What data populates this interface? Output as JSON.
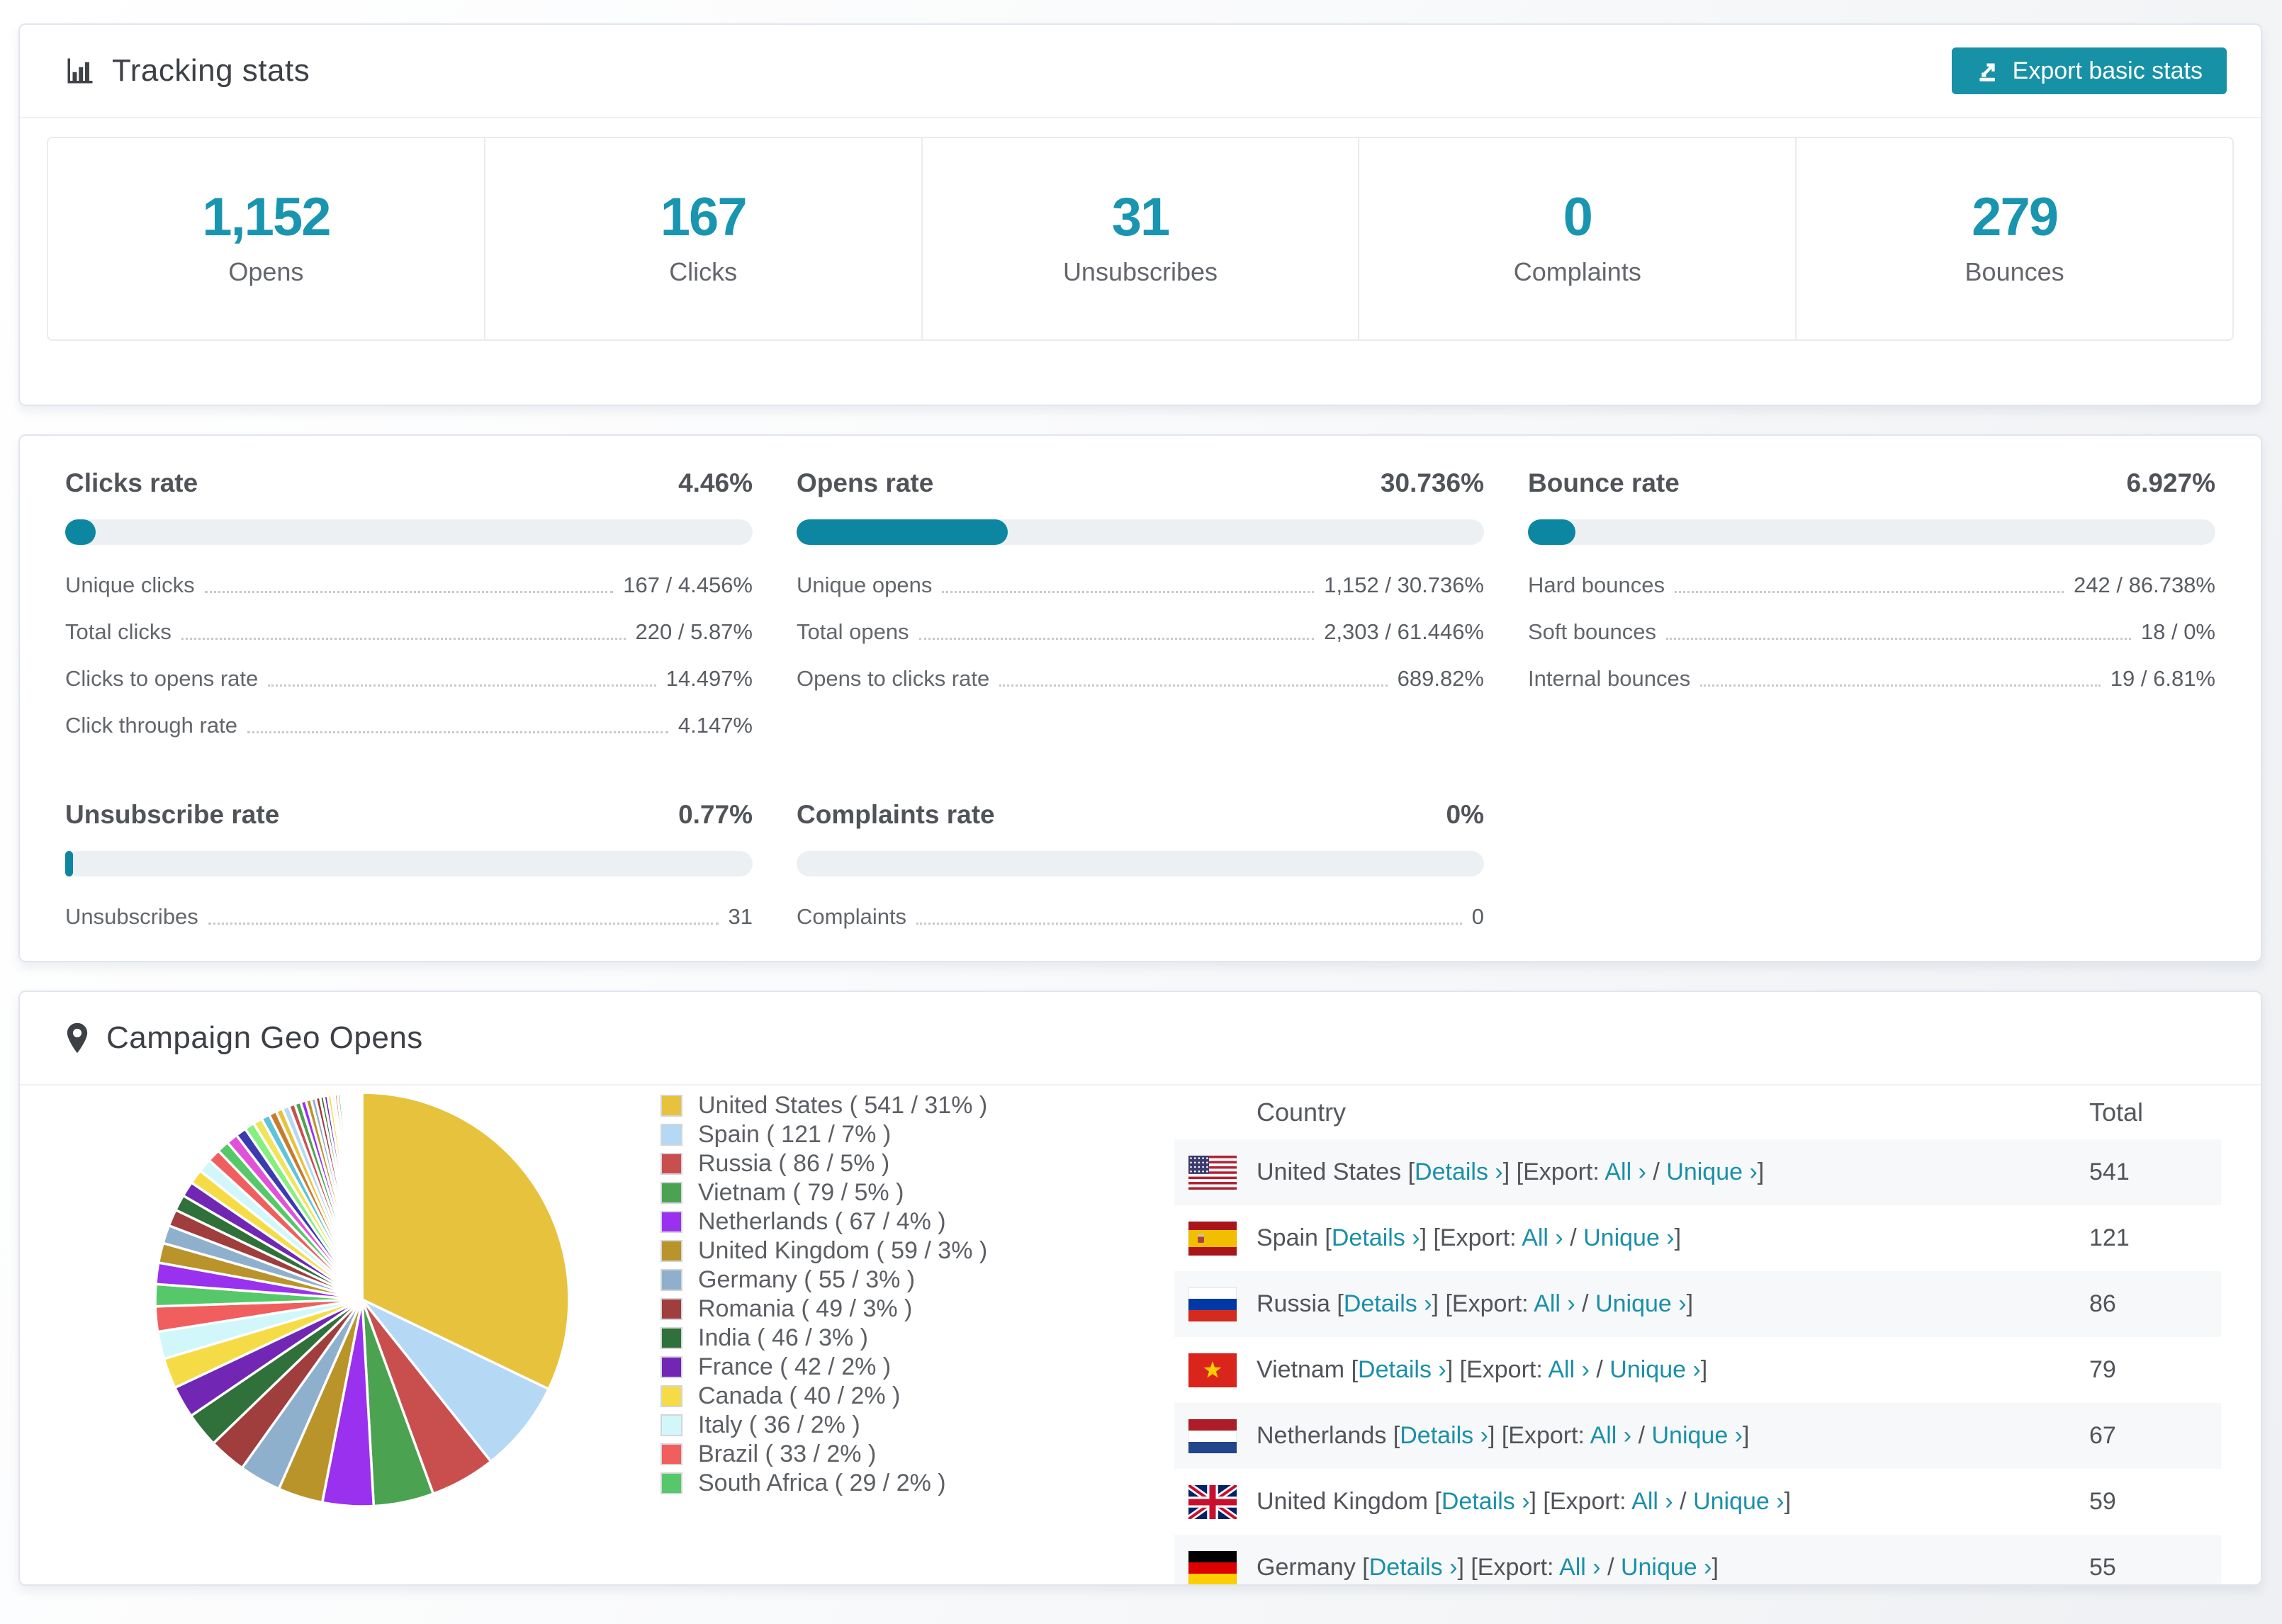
{
  "colors": {
    "accent_button": "#1791a6",
    "stat_value": "#1995b0",
    "bar_fill": "#0d87a1",
    "link": "#1a90a8",
    "bar_track": "#edf0f3"
  },
  "tracking": {
    "title": "Tracking stats",
    "export_label": "Export basic stats",
    "stats": [
      {
        "value": "1,152",
        "label": "Opens"
      },
      {
        "value": "167",
        "label": "Clicks"
      },
      {
        "value": "31",
        "label": "Unsubscribes"
      },
      {
        "value": "0",
        "label": "Complaints"
      },
      {
        "value": "279",
        "label": "Bounces"
      }
    ]
  },
  "rates": {
    "blocks": [
      {
        "title": "Clicks rate",
        "value": "4.46%",
        "percent": 4.46,
        "rows": [
          [
            "Unique clicks",
            "167 / 4.456%"
          ],
          [
            "Total clicks",
            "220 / 5.87%"
          ],
          [
            "Clicks to opens rate",
            "14.497%"
          ],
          [
            "Click through rate",
            "4.147%"
          ]
        ]
      },
      {
        "title": "Opens rate",
        "value": "30.736%",
        "percent": 30.736,
        "rows": [
          [
            "Unique opens",
            "1,152 / 30.736%"
          ],
          [
            "Total opens",
            "2,303 / 61.446%"
          ],
          [
            "Opens to clicks rate",
            "689.82%"
          ]
        ]
      },
      {
        "title": "Bounce rate",
        "value": "6.927%",
        "percent": 6.927,
        "rows": [
          [
            "Hard bounces",
            "242 / 86.738%"
          ],
          [
            "Soft bounces",
            "18 / 0%"
          ],
          [
            "Internal bounces",
            "19 / 6.81%"
          ]
        ]
      },
      {
        "title": "Unsubscribe rate",
        "value": "0.77%",
        "percent": 0.77,
        "rows": [
          [
            "Unsubscribes",
            "31"
          ]
        ]
      },
      {
        "title": "Complaints rate",
        "value": "0%",
        "percent": 0,
        "rows": [
          [
            "Complaints",
            "0"
          ]
        ]
      }
    ]
  },
  "geo": {
    "title": "Campaign Geo Opens",
    "legend_format": "{label} ( {value} / {percent} )",
    "palette_extra": [
      "#e052d8",
      "#3b3bb0",
      "#86ef7e",
      "#f0e45c",
      "#5ec4dc",
      "#c97b2d"
    ],
    "chart_data": {
      "type": "pie",
      "title": "Campaign Geo Opens",
      "unit": "opens",
      "labels": [
        "United States",
        "Spain",
        "Russia",
        "Vietnam",
        "Netherlands",
        "United Kingdom",
        "Germany",
        "Romania",
        "India",
        "France",
        "Canada",
        "Italy",
        "Brazil",
        "South Africa"
      ],
      "values": [
        541,
        121,
        86,
        79,
        67,
        59,
        55,
        49,
        46,
        42,
        40,
        36,
        33,
        29
      ],
      "percents": [
        "31%",
        "7%",
        "5%",
        "5%",
        "4%",
        "3%",
        "3%",
        "3%",
        "3%",
        "2%",
        "2%",
        "2%",
        "2%",
        "2%"
      ],
      "colors": [
        "#e7c23d",
        "#b5d8f5",
        "#c94f4f",
        "#4ba351",
        "#9a31ee",
        "#b9942a",
        "#8fb0cd",
        "#a03d3d",
        "#30703a",
        "#7127b4",
        "#f5dc47",
        "#d2f7fa",
        "#f15e5e",
        "#57c869"
      ],
      "tail_estimated": [
        28,
        26,
        24,
        22,
        21,
        20,
        19,
        18,
        17,
        16,
        15,
        14,
        13,
        12,
        11,
        10,
        9,
        9,
        8,
        8,
        7,
        7,
        6,
        6,
        5,
        5,
        5,
        4,
        4,
        4,
        3,
        3,
        3,
        3,
        2,
        2,
        2,
        2,
        2,
        1,
        1,
        1,
        1,
        1,
        1
      ],
      "start_angle": 0,
      "direction": "clockwise",
      "legend_position": "right"
    },
    "table": {
      "headers": [
        "Country",
        "Total"
      ],
      "links": {
        "details": "Details ›",
        "all": "All ›",
        "unique": "Unique ›"
      },
      "punct": {
        "open": " [",
        "close_export": "] [Export: ",
        "slash": " / ",
        "close": "]"
      },
      "rows": [
        {
          "country": "United States",
          "total": "541",
          "flag": "us"
        },
        {
          "country": "Spain",
          "total": "121",
          "flag": "es"
        },
        {
          "country": "Russia",
          "total": "86",
          "flag": "ru"
        },
        {
          "country": "Vietnam",
          "total": "79",
          "flag": "vn"
        },
        {
          "country": "Netherlands",
          "total": "67",
          "flag": "nl"
        },
        {
          "country": "United Kingdom",
          "total": "59",
          "flag": "gb"
        },
        {
          "country": "Germany",
          "total": "55",
          "flag": "de"
        }
      ]
    }
  }
}
